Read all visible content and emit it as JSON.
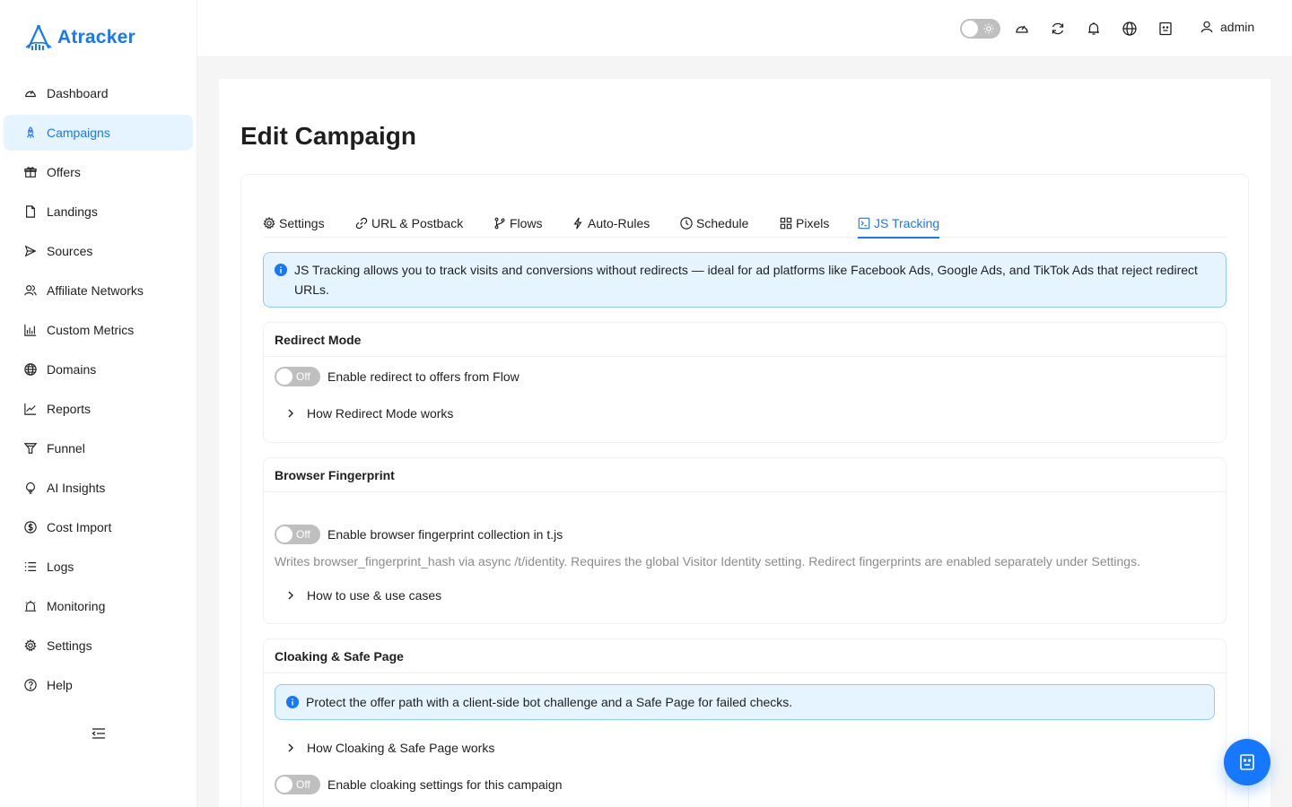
{
  "app": {
    "name": "Atracker"
  },
  "sidebar": {
    "items": [
      {
        "label": "Dashboard",
        "icon": "dashboard-icon"
      },
      {
        "label": "Campaigns",
        "icon": "rocket-icon",
        "active": true
      },
      {
        "label": "Offers",
        "icon": "gift-icon"
      },
      {
        "label": "Landings",
        "icon": "file-icon"
      },
      {
        "label": "Sources",
        "icon": "send-icon"
      },
      {
        "label": "Affiliate Networks",
        "icon": "team-icon"
      },
      {
        "label": "Custom Metrics",
        "icon": "bar-chart-icon"
      },
      {
        "label": "Domains",
        "icon": "globe-icon"
      },
      {
        "label": "Reports",
        "icon": "line-chart-icon"
      },
      {
        "label": "Funnel",
        "icon": "funnel-icon"
      },
      {
        "label": "AI Insights",
        "icon": "bulb-icon"
      },
      {
        "label": "Cost Import",
        "icon": "dollar-icon"
      },
      {
        "label": "Logs",
        "icon": "list-icon"
      },
      {
        "label": "Monitoring",
        "icon": "alert-icon"
      },
      {
        "label": "Settings",
        "icon": "gear-icon"
      },
      {
        "label": "Help",
        "icon": "question-icon"
      }
    ]
  },
  "header": {
    "user": "admin"
  },
  "page": {
    "title": "Edit Campaign"
  },
  "tabs": [
    {
      "label": "Settings",
      "icon": "gear-icon"
    },
    {
      "label": "URL & Postback",
      "icon": "link-icon"
    },
    {
      "label": "Flows",
      "icon": "branch-icon"
    },
    {
      "label": "Auto-Rules",
      "icon": "thunderbolt-icon"
    },
    {
      "label": "Schedule",
      "icon": "clock-icon"
    },
    {
      "label": "Pixels",
      "icon": "appstore-icon"
    },
    {
      "label": "JS Tracking",
      "icon": "code-icon",
      "active": true
    }
  ],
  "info": {
    "text": "JS Tracking allows you to track visits and conversions without redirects — ideal for ad platforms like Facebook Ads, Google Ads, and TikTok Ads that reject redirect URLs."
  },
  "redirect_mode": {
    "title": "Redirect Mode",
    "switch_label": "Off",
    "switch_on": false,
    "label": "Enable redirect to offers from Flow",
    "expand": "How Redirect Mode works"
  },
  "fingerprint": {
    "title": "Browser Fingerprint",
    "switch_label": "Off",
    "switch_on": false,
    "label": "Enable browser fingerprint collection in t.js",
    "description": "Writes browser_fingerprint_hash via async /t/identity. Requires the global Visitor Identity setting. Redirect fingerprints are enabled separately under Settings.",
    "expand": "How to use & use cases"
  },
  "cloaking": {
    "title": "Cloaking & Safe Page",
    "info": "Protect the offer path with a client-side bot challenge and a Safe Page for failed checks.",
    "expand": "How Cloaking & Safe Page works",
    "switch_label": "Off",
    "switch_on": false,
    "label": "Enable cloaking settings for this campaign"
  },
  "colors": {
    "accent": "#1677ff",
    "accent_bg": "#e6f4ff",
    "switch_off": "#bfbfbf"
  }
}
